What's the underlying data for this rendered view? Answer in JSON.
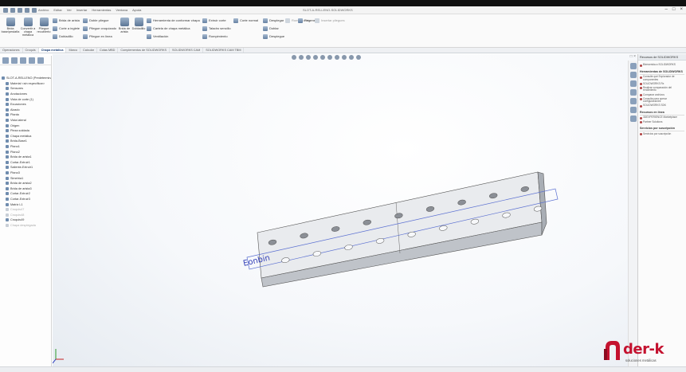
{
  "title_bar": {
    "menus": [
      "Archivo",
      "Editar",
      "Ver",
      "Insertar",
      "Herramientas",
      "Ventana",
      "Ayuda"
    ],
    "document": "SLOT-A-RELLENO-SOLIDWORKS",
    "window_controls": [
      "–",
      "□",
      "×"
    ]
  },
  "ribbon": {
    "big_buttons": [
      {
        "label": "Brida base/pestaña",
        "icon": "base-flange-icon"
      },
      {
        "label": "Convertir a chapa metálica",
        "icon": "convert-sheet-icon"
      },
      {
        "label": "Pliegue recubierto",
        "icon": "lofted-bend-icon"
      },
      {
        "label": "Brida de arista",
        "icon": "edge-flange-icon"
      },
      {
        "label": "Dobladillo",
        "icon": "hem-icon"
      },
      {
        "label": "Desplegar",
        "icon": "unfold-icon"
      },
      {
        "label": "Extruir corte",
        "icon": "extruded-cut-icon"
      },
      {
        "label": "Redondeo",
        "icon": "fillet-icon"
      },
      {
        "label": "Chaflán",
        "icon": "chamfer-icon"
      },
      {
        "label": "Simetría",
        "icon": "mirror-icon"
      }
    ],
    "small_buttons": [
      {
        "label": "Brida de arista",
        "icon": "edge-flange-small-icon"
      },
      {
        "label": "Corte a inglete",
        "icon": "miter-icon"
      },
      {
        "label": "Dobladillo",
        "icon": "hem-small-icon"
      },
      {
        "label": "Doble pliegue",
        "icon": "jog-icon"
      },
      {
        "label": "Pliegue croquizado",
        "icon": "sketched-bend-icon"
      },
      {
        "label": "Pliegue en línea",
        "icon": "line-bend-icon"
      },
      {
        "label": "Esquinas",
        "icon": "corners-icon"
      },
      {
        "label": "Herramienta de conformar chapa",
        "icon": "forming-tool-icon"
      },
      {
        "label": "Cartela de chapa metálica",
        "icon": "gusset-icon"
      },
      {
        "label": "Ventilación",
        "icon": "vent-icon"
      },
      {
        "label": "Extruir corte",
        "icon": "cut-small-icon"
      },
      {
        "label": "Taladro sencillo",
        "icon": "hole-icon"
      },
      {
        "label": "Rompimiento",
        "icon": "rip-icon"
      },
      {
        "label": "Corte normal",
        "icon": "normal-cut-icon"
      },
      {
        "label": "Desplegar",
        "icon": "unfold-small-icon"
      },
      {
        "label": "Doblar",
        "icon": "fold-icon"
      },
      {
        "label": "Despiegue",
        "icon": "flatten-icon"
      }
    ],
    "disabled_buttons": [
      {
        "label": "Rompimiento",
        "icon": "disabled-rip-icon"
      },
      {
        "label": "Operación",
        "icon": "disabled-operation-icon"
      },
      {
        "label": "Regenerar",
        "icon": "rebuild-icon"
      },
      {
        "label": "Insertar pliegues",
        "icon": "insert-bends-icon"
      }
    ]
  },
  "tabs": [
    "Operaciones",
    "Croquis",
    "Chapa metálica",
    "Marco",
    "Calcular",
    "Cotas MBD",
    "Complementos de SOLIDWORKS",
    "SOLIDWORKS CAM",
    "SOLIDWORKS CAM TBM"
  ],
  "active_tab": "Chapa metálica",
  "tree": {
    "nodes": [
      {
        "label": "SLOT-A-RELLENO (Predeterminado)",
        "grey": false
      },
      {
        "label": "Material <sin especificar>",
        "grey": false
      },
      {
        "label": "Sensores",
        "grey": false
      },
      {
        "label": "Anotaciones",
        "grey": false
      },
      {
        "label": "Vista de corte (1)",
        "grey": false
      },
      {
        "label": "Ecuaciones",
        "grey": false
      },
      {
        "label": "Alzado",
        "grey": false
      },
      {
        "label": "Planta",
        "grey": false
      },
      {
        "label": "Vista lateral",
        "grey": false
      },
      {
        "label": "Origen",
        "grey": false
      },
      {
        "label": "Pieza soldada",
        "grey": false
      },
      {
        "label": "Chapa metálica",
        "grey": false
      },
      {
        "label": "Brida-Base1",
        "grey": false
      },
      {
        "label": "Plano1",
        "grey": false
      },
      {
        "label": "Plano2",
        "grey": false
      },
      {
        "label": "Brida de arista1",
        "grey": false
      },
      {
        "label": "Cortar-Extruir1",
        "grey": false
      },
      {
        "label": "Saliente-Extruir1",
        "grey": false
      },
      {
        "label": "Plano3",
        "grey": false
      },
      {
        "label": "Simetría1",
        "grey": false
      },
      {
        "label": "Brida de arista2",
        "grey": false
      },
      {
        "label": "Brida de arista3",
        "grey": false
      },
      {
        "label": "Cortar-Extruir2",
        "grey": false
      },
      {
        "label": "Cortar-Extruir3",
        "grey": false
      },
      {
        "label": "Matriz L1",
        "grey": false
      },
      {
        "label": "Croquis47",
        "grey": true
      },
      {
        "label": "Croquis48",
        "grey": true
      },
      {
        "label": "Croquis49",
        "grey": false
      },
      {
        "label": "Chapa desplegada",
        "grey": true
      }
    ]
  },
  "viewport": {
    "engraved_text": "Eonbin",
    "controls": "□ ×"
  },
  "taskpane": {
    "title": "Recursos de SOLIDWORKS",
    "sections": [
      {
        "title": "",
        "items": [
          "Bienvenida a SOLIDWORKS"
        ]
      },
      {
        "title": "Herramientas de SOLIDWORKS",
        "items": [
          "Consulte qué Explorador de componentes",
          "SOLIDWORKS Rx",
          "Realizar comparación del rendimiento",
          "Comparar archivos",
          "Consulta para operar configuraciones",
          "SOLIDWORKS SDK"
        ]
      },
      {
        "title": "Recursos en línea",
        "items": [
          "3DEXPERIENCE Marketplace",
          "Partner Solutions"
        ]
      },
      {
        "title": "Servicios por suscripción",
        "items": [
          "Servicios por suscripción"
        ]
      }
    ]
  },
  "logo": {
    "wordmark": "der-k",
    "tagline": "soluciones metálicas",
    "brand_color": "#c4122f"
  }
}
